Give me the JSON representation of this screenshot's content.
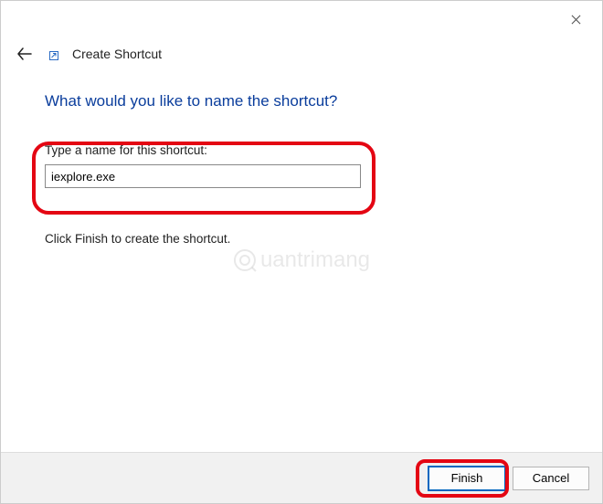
{
  "window": {
    "title": "Create Shortcut"
  },
  "heading": "What would you like to name the shortcut?",
  "form": {
    "label": "Type a name for this shortcut:",
    "value": "iexplore.exe"
  },
  "hint": "Click Finish to create the shortcut.",
  "watermark": "uantrimang",
  "footer": {
    "finish": "Finish",
    "cancel": "Cancel"
  }
}
